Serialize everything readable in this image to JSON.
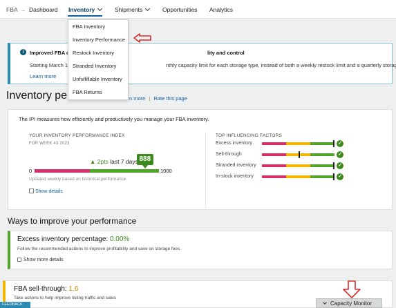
{
  "nav": {
    "home": "FBA",
    "items": [
      {
        "label": "Dashboard"
      },
      {
        "label": "Inventory"
      },
      {
        "label": "Shipments"
      },
      {
        "label": "Opportunities"
      },
      {
        "label": "Analytics"
      }
    ]
  },
  "dropdown": {
    "items": [
      {
        "label": "FBA Inventory"
      },
      {
        "label": "Inventory Performance"
      },
      {
        "label": "Restock Inventory"
      },
      {
        "label": "Stranded Inventory"
      },
      {
        "label": "Unfulfillable Inventory"
      },
      {
        "label": "FBA Returns"
      }
    ]
  },
  "banner": {
    "title_start": "Improved FBA cap",
    "title_end": "lity and control",
    "desc_start": "Starting March 1, 2",
    "desc_end": "nthly capacity limit for each storage type, instead of both a weekly restock limit and a quarterly storage limit.",
    "learn_more": "Learn more"
  },
  "ipi": {
    "title": "Inventory performance",
    "learn_more": "Learn more",
    "separator": "|",
    "rate": "Rate this page",
    "intro": "The IPI measures how efficiently and productively you manage your FBA inventory.",
    "section_label": "YOUR INVENTORY PERFORMANCE INDEX",
    "week": "FOR WEEK 43 2023",
    "score": "888",
    "change": "2pts",
    "change_suffix": "last 7 days",
    "min": "0",
    "max": "1000",
    "score_fraction": 0.888,
    "updated": "Updated weekly based on historical performance",
    "show_details": "Show details"
  },
  "factors": {
    "title": "TOP INFLUENCING FACTORS",
    "items": [
      {
        "label": "Excess inventory",
        "position": 1.0
      },
      {
        "label": "Sell-through",
        "position": 0.52
      },
      {
        "label": "Stranded inventory",
        "position": 1.0
      },
      {
        "label": "In-stock inventory",
        "position": 1.0
      }
    ]
  },
  "ways": {
    "title": "Ways to improve your performance"
  },
  "excess": {
    "label": "Excess inventory percentage:",
    "value": "0.00%",
    "desc": "Follow the recommended actions to improve profitability and save on storage fees.",
    "show_more": "Show more details"
  },
  "sell": {
    "label": "FBA sell-through:",
    "value": "1.6",
    "desc": "Take actions to help improve listing traffic and sales"
  },
  "feedback": "FEEDBACK",
  "capacity_monitor": "Capacity Monitor",
  "colors": {
    "accent": "#0b5ea3",
    "red": "#d6306a",
    "yellow": "#f2b705",
    "green": "#50a52b",
    "annotation": "#d92b2b"
  }
}
